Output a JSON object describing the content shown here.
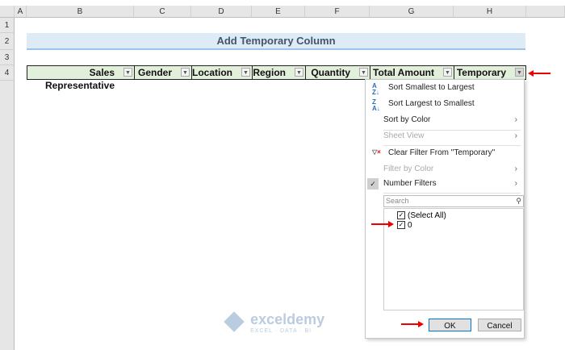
{
  "columns": [
    "A",
    "B",
    "C",
    "D",
    "E",
    "F",
    "G",
    "H"
  ],
  "rows": [
    "1",
    "2",
    "3",
    "4"
  ],
  "title": "Add Temporary Column",
  "headers": [
    "Sales Representative",
    "Gender",
    "Location",
    "Region",
    "Quantity",
    "Total Amount",
    "Temporary"
  ],
  "menu": {
    "sort_asc": "Sort Smallest to Largest",
    "sort_desc": "Sort Largest to Smallest",
    "sort_color": "Sort by Color",
    "sheet_view": "Sheet View",
    "clear_filter": "Clear Filter From \"Temporary\"",
    "filter_color": "Filter by Color",
    "number_filters": "Number Filters",
    "search_placeholder": "Search",
    "items": [
      "(Select All)",
      "0"
    ],
    "ok": "OK",
    "cancel": "Cancel"
  },
  "watermark": {
    "name": "exceldemy",
    "tagline": "EXCEL · DATA · BI"
  }
}
